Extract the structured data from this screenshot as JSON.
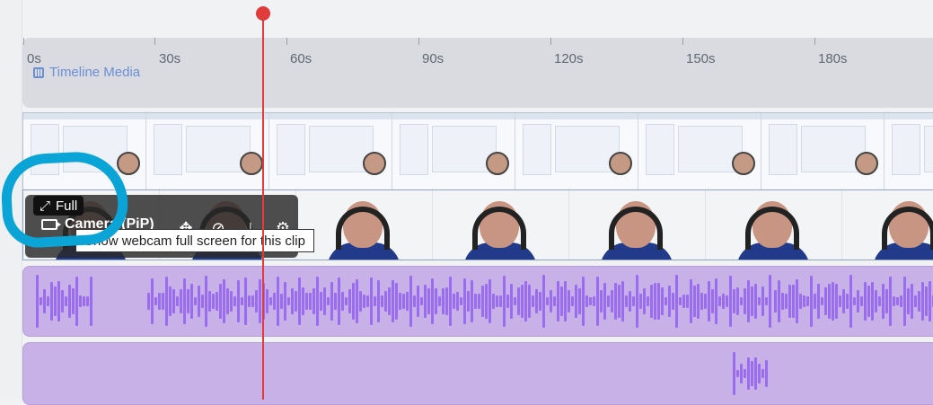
{
  "ruler": {
    "ticks": [
      "0s",
      "30s",
      "60s",
      "90s",
      "120s",
      "150s",
      "180s"
    ],
    "lane_label": "Timeline Media",
    "lane_icon": "film-icon"
  },
  "camera_clip": {
    "full_label": "Full",
    "track_label": "Camera (PiP)",
    "tooltip": "Show webcam full screen for this clip"
  },
  "colors": {
    "playhead": "#e23b3b",
    "audio_wave": "#9a6cf1",
    "highlight": "#0ba4d6"
  }
}
